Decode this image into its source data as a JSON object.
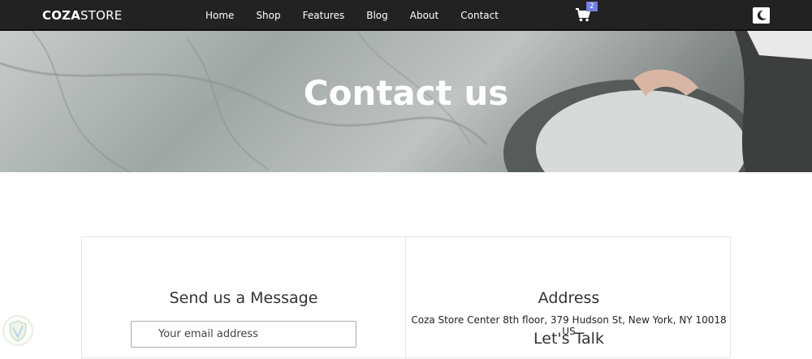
{
  "nav": {
    "logo_bold": "COZA",
    "logo_light": "STORE",
    "links": [
      "Home",
      "Shop",
      "Features",
      "Blog",
      "About",
      "Contact"
    ],
    "cart_count": "2"
  },
  "hero": {
    "title": "Contact us"
  },
  "form": {
    "heading": "Send us a Message",
    "email_placeholder": "Your email address"
  },
  "info": {
    "address_heading": "Address",
    "address_text": "Coza Store Center 8th floor, 379 Hudson St, New York, NY 10018 US",
    "talk_heading": "Let's Talk"
  },
  "colors": {
    "navbar": "#222222",
    "accent": "#717fe0"
  }
}
